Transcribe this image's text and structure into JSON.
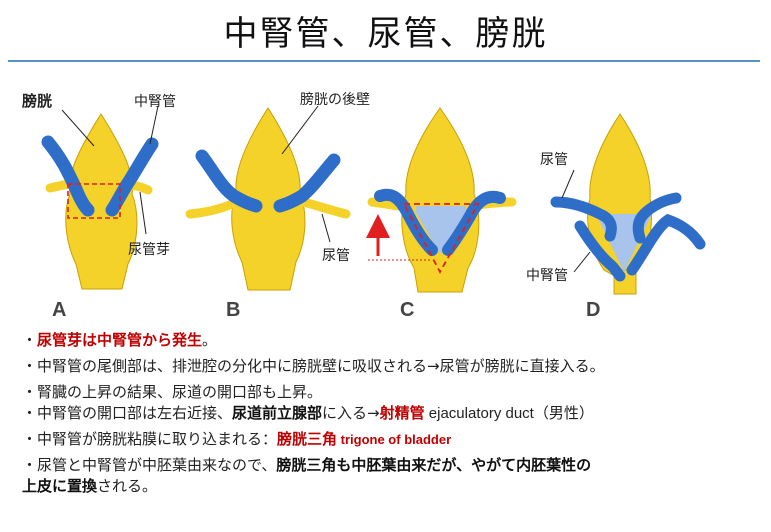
{
  "title": "中腎管、尿管、膀胱",
  "figure": {
    "labels": {
      "bladder": "膀胱",
      "mesonephric_duct_a": "中腎管",
      "ureteric_bud": "尿管芽",
      "bladder_posterior_wall": "膀胱の後壁",
      "ureter_b": "尿管",
      "ureter_d": "尿管",
      "mesonephric_duct_d": "中腎管"
    },
    "panels": [
      "A",
      "B",
      "C",
      "D"
    ],
    "colors": {
      "bladder": "#f5d22a",
      "duct": "#2f6ec8",
      "trigone": "#a8c4ec",
      "highlight": "#e02020"
    }
  },
  "bullets": {
    "b1": {
      "mark": "・",
      "red": "尿管芽は中腎管から発生",
      "end": "。"
    },
    "b2": {
      "text": "・中腎管の尾側部は、排泄腔の分化中に膀胱壁に吸収される→尿管が膀胱に直接入る。"
    },
    "b3": {
      "text": "・腎臓の上昇の結果、尿道の開口部も上昇。"
    },
    "b4": {
      "pre": "・中腎管の開口部は左右近接、",
      "bold": "尿道前立腺部",
      "mid": "に入る→",
      "red": "射精管",
      "en": " ejaculatory duct",
      "post": "（男性）"
    },
    "b5": {
      "pre": "・中腎管が膀胱粘膜に取り込まれる：",
      "red": "膀胱三角",
      "en": " trigone of bladder"
    },
    "b6": {
      "pre": "・尿管と中腎管が中胚葉由来なので、",
      "bold1": "膀胱三角も中胚葉由来だが、やがて内胚葉性の",
      "bold2": "上皮に置換",
      "post": "される。"
    }
  }
}
